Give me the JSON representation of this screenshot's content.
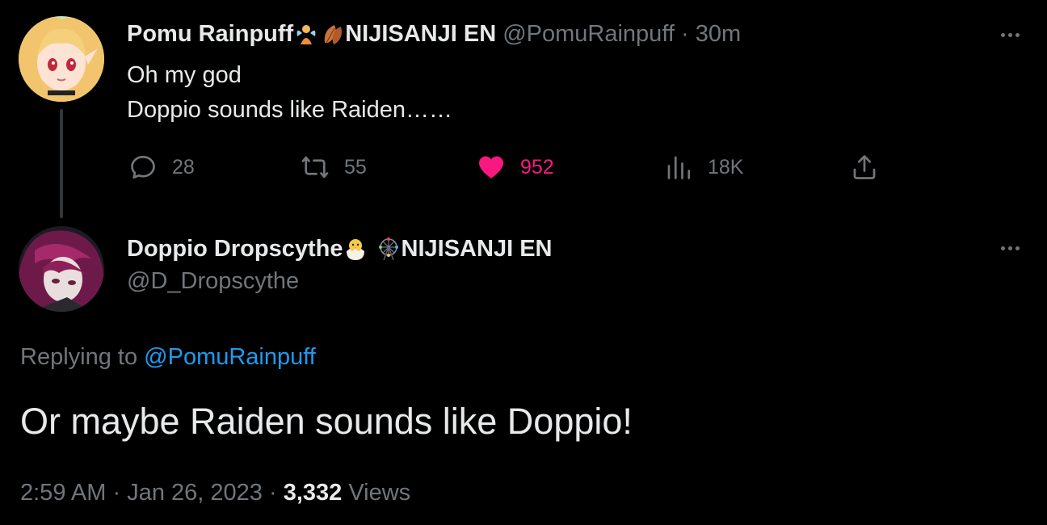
{
  "parent_tweet": {
    "author_name": "Pomu Rainpuff",
    "name_emoji_1": "fairy-emoji",
    "name_emoji_2": "leaf-emoji",
    "org": "NIJISANJI EN",
    "handle": "@PomuRainpuff",
    "separator": "·",
    "time_ago": "30m",
    "text_line_1": "Oh my god",
    "text_line_2": "Doppio sounds like Raiden……",
    "actions": {
      "replies": "28",
      "retweets": "55",
      "likes": "952",
      "views": "18K"
    },
    "liked": true,
    "like_color": "#f91880"
  },
  "reply_tweet": {
    "author_name": "Doppio Dropscythe",
    "name_emoji_1": "hatching-chick-emoji",
    "name_emoji_2": "ferris-wheel-emoji",
    "org": "NIJISANJI EN",
    "handle": "@D_Dropscythe",
    "replying_prefix": "Replying to",
    "replying_to": "@PomuRainpuff",
    "text": "Or maybe Raiden sounds like Doppio!",
    "time": "2:59 AM",
    "separator": "·",
    "date": "Jan 26, 2023",
    "views_count": "3,332",
    "views_label": "Views"
  },
  "colors": {
    "background": "#000000",
    "primary_text": "#e7e9ea",
    "secondary_text": "#71767b",
    "link": "#1d9bf0",
    "like": "#f91880"
  }
}
